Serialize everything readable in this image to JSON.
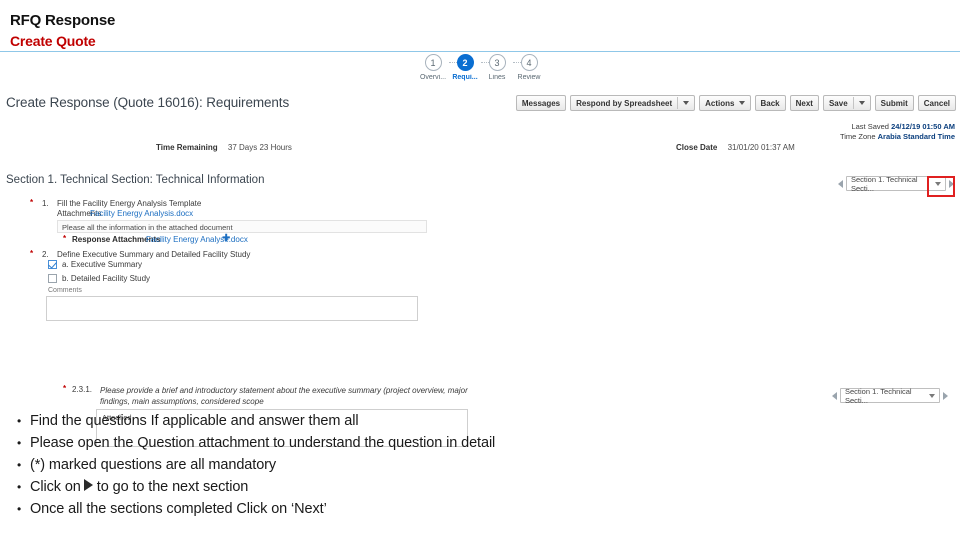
{
  "slide": {
    "title": "RFQ Response",
    "subtitle": "Create Quote",
    "subtitle_color": "#c00000",
    "accent_rule_color": "#8fc7e8"
  },
  "app": {
    "steps": [
      {
        "number": "1",
        "label": "Overvi...",
        "active": false
      },
      {
        "number": "2",
        "label": "Requi...",
        "active": true
      },
      {
        "number": "3",
        "label": "Lines",
        "active": false
      },
      {
        "number": "4",
        "label": "Review",
        "active": false
      }
    ],
    "active_step_color": "#0a6ed1",
    "page_title": "Create Response (Quote 16016): Requirements",
    "toolbar": [
      {
        "label": "Messages",
        "caret": false,
        "split": false
      },
      {
        "label": "Respond by Spreadsheet",
        "caret": true,
        "split": true
      },
      {
        "label": "Actions",
        "caret": true,
        "split": false
      },
      {
        "label": "Back",
        "caret": false,
        "split": false
      },
      {
        "label": "Next",
        "caret": false,
        "split": false
      },
      {
        "label": "Save",
        "caret": true,
        "split": true
      },
      {
        "label": "Submit",
        "caret": false,
        "split": false
      },
      {
        "label": "Cancel",
        "caret": false,
        "split": false
      }
    ],
    "meta": {
      "time_remaining_label": "Time Remaining",
      "time_remaining_value": "37 Days 23 Hours",
      "close_date_label": "Close Date",
      "close_date_value": "31/01/20 01:37 AM",
      "last_saved_label": "Last Saved",
      "last_saved_value": "24/12/19 01:50 AM",
      "time_zone_label": "Time Zone",
      "time_zone_value": "Arabia Standard Time"
    },
    "section_heading": "Section 1. Technical Section: Technical Information",
    "section_selector": {
      "value": "Section 1. Technical Secti...",
      "prev_icon": "chevron-left-icon",
      "next_icon": "chevron-right-icon",
      "dropdown_icon": "chevron-down-icon"
    },
    "highlight_color": "#e02020",
    "questions": {
      "q1": {
        "required_mark": "*",
        "number": "1.",
        "text": "Fill the Facility Energy Analysis Template",
        "attachments_label": "Attachments",
        "attachment_link": "Facility Energy Analysis.docx",
        "instruction": "Please all the information in the attached document",
        "response_required_mark": "*",
        "response_label": "Response Attachments",
        "response_file": "Facility Energy Analyse.docx",
        "add_icon": "plus-icon"
      },
      "q2": {
        "required_mark": "*",
        "number": "2.",
        "text": "Define Executive Summary and Detailed Facility Study",
        "options": [
          {
            "label": "a. Executive Summary",
            "checked": true
          },
          {
            "label": "b. Detailed Facility Study",
            "checked": false
          }
        ],
        "comments_label": "Comments",
        "comments_value": ""
      },
      "q231": {
        "required_mark": "*",
        "number": "2.3.1.",
        "text": "Please provide a brief and introductory statement about the executive summary (project overview, major findings, main assumptions, considered scope",
        "answer_value": "Attached"
      }
    }
  },
  "instructions": {
    "bullets": [
      {
        "pre": "Find the questions If applicable and answer them all",
        "has_arrow": false,
        "post": ""
      },
      {
        "pre": "Please open the Question attachment to understand the question in detail",
        "has_arrow": false,
        "post": ""
      },
      {
        "pre": "(*) marked questions are all mandatory",
        "has_arrow": false,
        "post": ""
      },
      {
        "pre": "Click on",
        "has_arrow": true,
        "post": "to go to the next section"
      },
      {
        "pre": "Once all the sections completed Click on ‘Next’",
        "has_arrow": false,
        "post": ""
      }
    ]
  }
}
